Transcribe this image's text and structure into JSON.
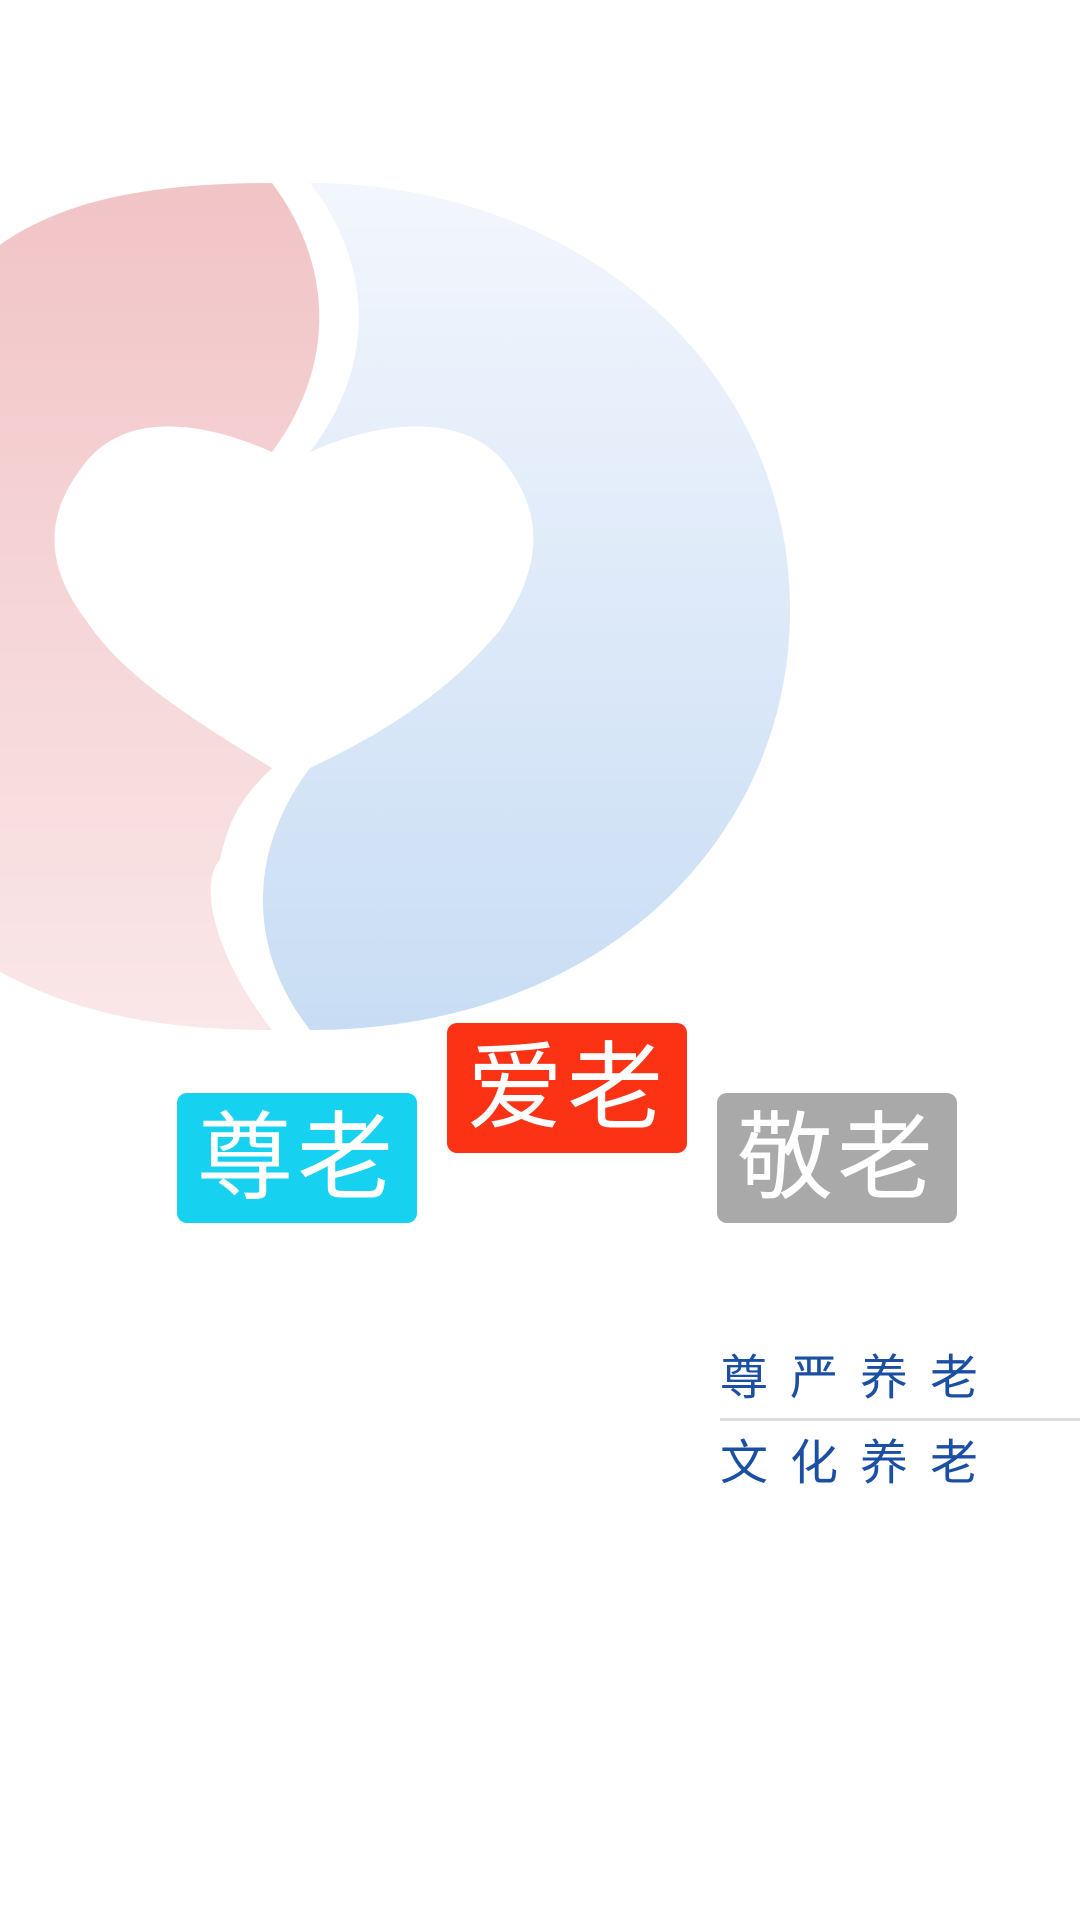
{
  "colors": {
    "background": "#ffffff",
    "logo_left_top": "#f1c4c6",
    "logo_left_bottom": "#fae7e8",
    "logo_right_top": "#f3f6fd",
    "logo_right_bottom": "#c8ddf4",
    "badge_zunlao": "#17d1f0",
    "badge_ailao": "#fb3214",
    "badge_jinglao": "#a9a9a9",
    "slogan_text": "#1b4fa3",
    "divider": "#dcdcdc"
  },
  "logo": {
    "icon": "heart-circle-logo-icon"
  },
  "badges": [
    {
      "label": "尊老"
    },
    {
      "label": "爱老"
    },
    {
      "label": "敬老"
    }
  ],
  "slogan": {
    "line1": "尊严养老",
    "line2": "文化养老"
  }
}
